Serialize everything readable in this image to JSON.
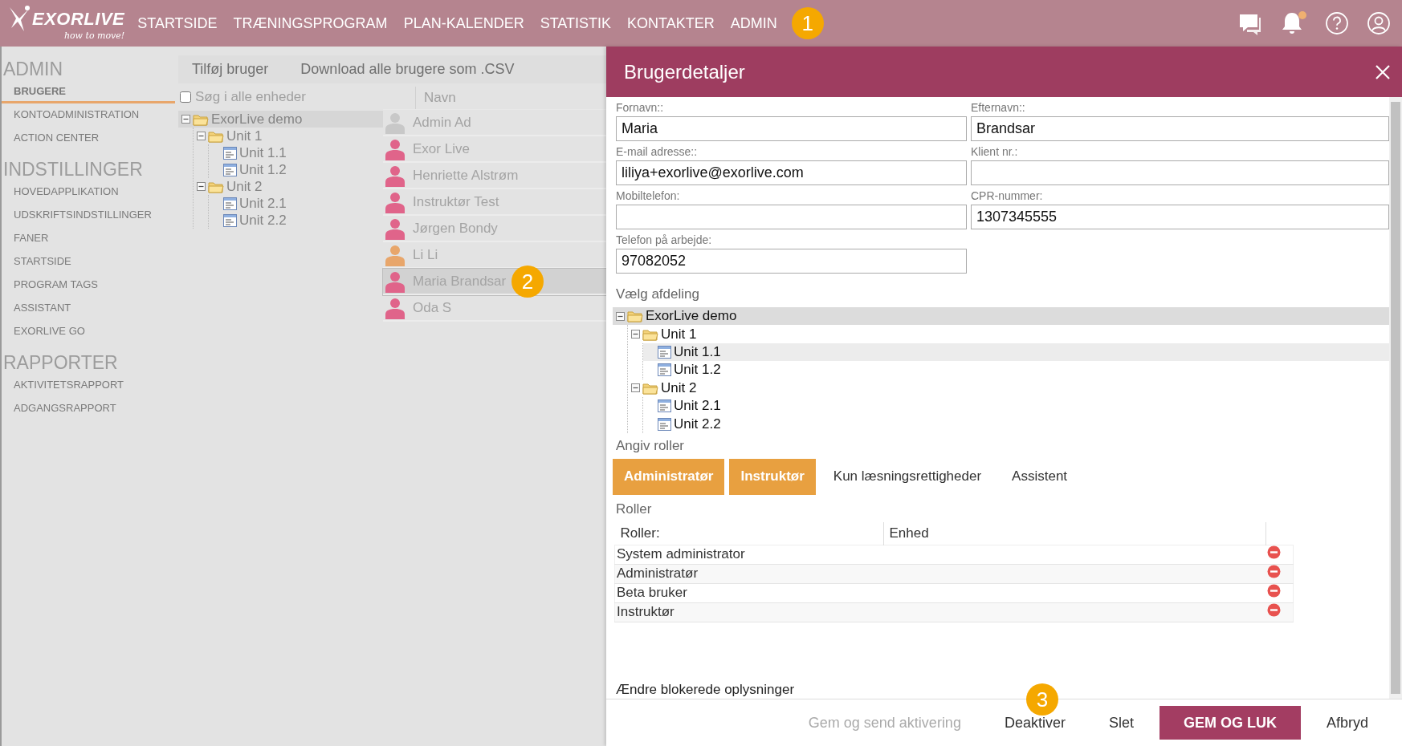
{
  "topbar": {
    "logo": {
      "name": "EXORLIVE",
      "tagline": "how to move!"
    },
    "nav": [
      {
        "label": "STARTSIDE"
      },
      {
        "label": "TRÆNINGSPROGRAM"
      },
      {
        "label": "PLAN-KALENDER"
      },
      {
        "label": "STATISTIK"
      },
      {
        "label": "KONTAKTER"
      },
      {
        "label": "ADMIN"
      }
    ],
    "callout": "1",
    "notifications_unread": true
  },
  "sidebar": {
    "sections": [
      {
        "title": "ADMIN",
        "items": [
          {
            "label": "BRUGERE",
            "selected": true
          },
          {
            "label": "KONTOADMINISTRATION",
            "selected": false
          },
          {
            "label": "ACTION CENTER",
            "selected": false
          }
        ]
      },
      {
        "title": "INDSTILLINGER",
        "items": [
          {
            "label": "HOVEDAPPLIKATION",
            "selected": false
          },
          {
            "label": "UDSKRIFTSINDSTILLINGER",
            "selected": false
          },
          {
            "label": "FANER",
            "selected": false
          },
          {
            "label": "STARTSIDE",
            "selected": false
          },
          {
            "label": "PROGRAM TAGS",
            "selected": false
          },
          {
            "label": "ASSISTANT",
            "selected": false
          },
          {
            "label": "EXORLIVE GO",
            "selected": false
          }
        ]
      },
      {
        "title": "RAPPORTER",
        "items": [
          {
            "label": "AKTIVITETSRAPPORT",
            "selected": false
          },
          {
            "label": "ADGANGSRAPPORT",
            "selected": false
          }
        ]
      }
    ]
  },
  "toolbar": {
    "actions": [
      "Tilføj bruger",
      "Download alle brugere som .CSV"
    ]
  },
  "unit_filter": {
    "label": "Søg i alle enheder",
    "checked": false
  },
  "unit_tree": [
    {
      "label": "ExorLive demo",
      "kind": "folder",
      "expanded": true,
      "selected": true,
      "children": [
        {
          "label": "Unit 1",
          "kind": "folder",
          "expanded": true,
          "selected": false,
          "children": [
            {
              "label": "Unit 1.1",
              "kind": "unit",
              "selected": false
            },
            {
              "label": "Unit 1.2",
              "kind": "unit",
              "selected": false
            }
          ]
        },
        {
          "label": "Unit 2",
          "kind": "folder",
          "expanded": true,
          "selected": false,
          "children": [
            {
              "label": "Unit 2.1",
              "kind": "unit",
              "selected": false
            },
            {
              "label": "Unit 2.2",
              "kind": "unit",
              "selected": false
            }
          ]
        }
      ]
    }
  ],
  "users": {
    "column": "Navn",
    "callout": "2",
    "rows": [
      {
        "name": "Admin Ad",
        "color": "#c8c8c8",
        "selected": false
      },
      {
        "name": "Exor Live",
        "color": "#e0648a",
        "selected": false
      },
      {
        "name": "Henriette Alstrøm",
        "color": "#e0648a",
        "selected": false
      },
      {
        "name": "Instruktør Test",
        "color": "#e0648a",
        "selected": false
      },
      {
        "name": "Jørgen Bondy",
        "color": "#e0648a",
        "selected": false
      },
      {
        "name": "Li Li",
        "color": "#e8a66b",
        "selected": false
      },
      {
        "name": "Maria Brandsar",
        "color": "#e0648a",
        "selected": true
      },
      {
        "name": "Oda S",
        "color": "#e0648a",
        "selected": false
      }
    ]
  },
  "user_details": {
    "title": "Brugerdetaljer",
    "fields": [
      {
        "label": "Fornavn::",
        "value": "Maria"
      },
      {
        "label": "Efternavn::",
        "value": "Brandsar"
      },
      {
        "label": "E-mail adresse::",
        "value": "liliya+exorlive@exorlive.com"
      },
      {
        "label": "Klient nr.:"
      },
      {
        "label": "Mobiltelefon:"
      },
      {
        "label": "CPR-nummer:",
        "value": "1307345555"
      },
      {
        "label": "Telefon på arbejde:",
        "value": "97082052"
      }
    ],
    "department_label": "Vælg afdeling",
    "department_tree": [
      {
        "label": "ExorLive demo",
        "kind": "folder",
        "expanded": true,
        "selected": true,
        "highlighted": false,
        "children": [
          {
            "label": "Unit 1",
            "kind": "folder",
            "expanded": true,
            "selected": false,
            "highlighted": false,
            "children": [
              {
                "label": "Unit 1.1",
                "kind": "unit",
                "selected": false,
                "highlighted": true
              },
              {
                "label": "Unit 1.2",
                "kind": "unit",
                "selected": false,
                "highlighted": false
              }
            ]
          },
          {
            "label": "Unit 2",
            "kind": "folder",
            "expanded": true,
            "selected": false,
            "highlighted": false,
            "children": [
              {
                "label": "Unit 2.1",
                "kind": "unit",
                "selected": false,
                "highlighted": false
              },
              {
                "label": "Unit 2.2",
                "kind": "unit",
                "selected": false,
                "highlighted": false
              }
            ]
          }
        ]
      }
    ],
    "roles_label": "Angiv roller",
    "role_tabs": [
      {
        "label": "Administratør",
        "selected": true
      },
      {
        "label": "Instruktør",
        "selected": true
      },
      {
        "label": "Kun læsningsrettigheder",
        "selected": false
      },
      {
        "label": "Assistent",
        "selected": false
      }
    ],
    "roles_table": {
      "title": "Roller",
      "columns": [
        "Roller:",
        "Enhed"
      ],
      "rows": [
        {
          "role": "System administrator"
        },
        {
          "role": "Administratør"
        },
        {
          "role": "Beta bruker"
        },
        {
          "role": "Instruktør"
        }
      ]
    },
    "blocked_info_link": "Ændre blokerede oplysninger",
    "callout": "3",
    "buttons": [
      {
        "label": "Gem og send aktivering",
        "kind": "text",
        "disabled": true
      },
      {
        "label": "Deaktiver",
        "kind": "text",
        "disabled": false
      },
      {
        "label": "Slet",
        "kind": "text",
        "disabled": false
      },
      {
        "label": "GEM OG LUK",
        "kind": "primary",
        "disabled": false
      },
      {
        "label": "Afbryd",
        "kind": "text",
        "disabled": false
      }
    ]
  }
}
